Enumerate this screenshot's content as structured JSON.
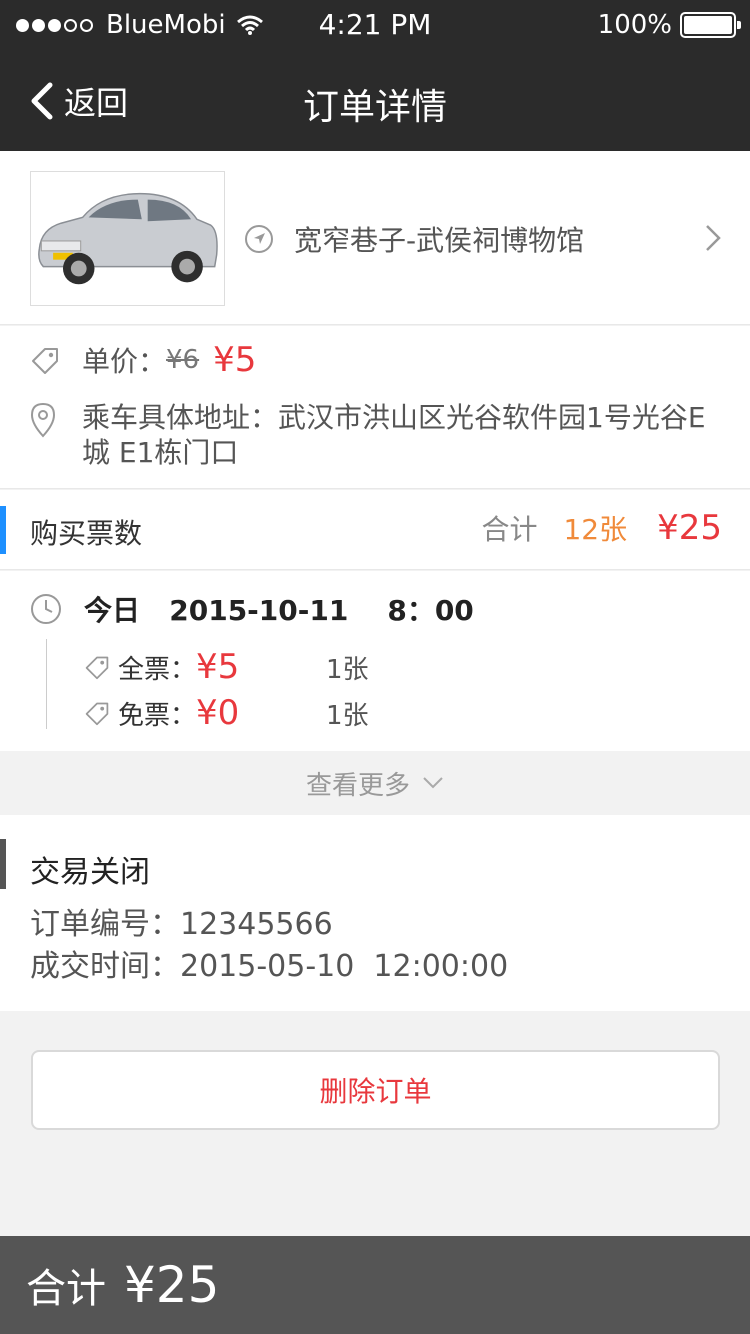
{
  "status_bar": {
    "carrier": "BlueMobi",
    "time": "4:21 PM",
    "battery": "100%"
  },
  "nav": {
    "back_label": "返回",
    "title": "订单详情"
  },
  "product": {
    "route": "宽窄巷子-武侯祠博物馆"
  },
  "info": {
    "price_label": "单价：",
    "old_price": "¥6",
    "new_price": "¥5",
    "address": "乘车具体地址：武汉市洪山区光谷软件园1号光谷E城 E1栋门口"
  },
  "tickets": {
    "label": "购买票数",
    "sum_label": "合计",
    "sum_count": "12张",
    "sum_total": "¥25"
  },
  "schedule": {
    "date_line": "今日   2015-10-11    8：00",
    "rows": [
      {
        "label": "全票：",
        "price": "¥5",
        "count": "1张"
      },
      {
        "label": "免票：",
        "price": "¥0",
        "count": "1张"
      }
    ]
  },
  "more": {
    "label": "查看更多"
  },
  "order": {
    "status": "交易关闭",
    "number": "订单编号：12345566",
    "deal_time": "成交时间：2015-05-10  12:00:00"
  },
  "actions": {
    "delete_label": "删除订单"
  },
  "footer": {
    "label": "合计",
    "total": "¥25"
  },
  "colors": {
    "accent_red": "#e8383d",
    "accent_orange": "#f08a3a",
    "accent_blue": "#1e90ff",
    "nav_bg": "#2b2b2b",
    "footer_bg": "#555555"
  }
}
